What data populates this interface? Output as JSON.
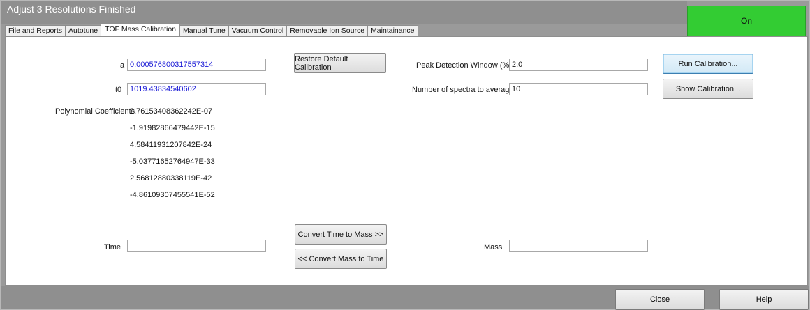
{
  "window": {
    "title": "Adjust 3 Resolutions Finished",
    "status": "On",
    "status_color": "#33cc33"
  },
  "tabs": [
    {
      "label": "File and Reports"
    },
    {
      "label": "Autotune"
    },
    {
      "label": "TOF Mass Calibration",
      "active": true
    },
    {
      "label": "Manual Tune"
    },
    {
      "label": "Vacuum Control"
    },
    {
      "label": "Removable Ion Source"
    },
    {
      "label": "Maintainance"
    }
  ],
  "calibration": {
    "a_label": "a",
    "a_value": "0.000576800317557314",
    "t0_label": "t0",
    "t0_value": "1019.43834540602",
    "poly_label": "Polynomial Coefficients",
    "coefficients": [
      "2.76153408362242E-07",
      "-1.91982866479442E-15",
      "4.58411931207842E-24",
      "-5.03771652764947E-33",
      "2.56812880338119E-42",
      "-4.86109307455541E-52"
    ],
    "restore_button": "Restore Default Calibration"
  },
  "settings": {
    "peak_window_label": "Peak Detection Window (%)",
    "peak_window_value": "2.0",
    "spectra_avg_label": "Number of spectra to average",
    "spectra_avg_value": "10",
    "run_button": "Run Calibration...",
    "show_button": "Show Calibration..."
  },
  "conversion": {
    "time_label": "Time",
    "time_value": "",
    "mass_label": "Mass",
    "mass_value": "",
    "to_mass_button": "Convert Time to Mass >>",
    "to_time_button": "<< Convert Mass to Time"
  },
  "footer": {
    "close_button": "Close",
    "help_button": "Help"
  }
}
